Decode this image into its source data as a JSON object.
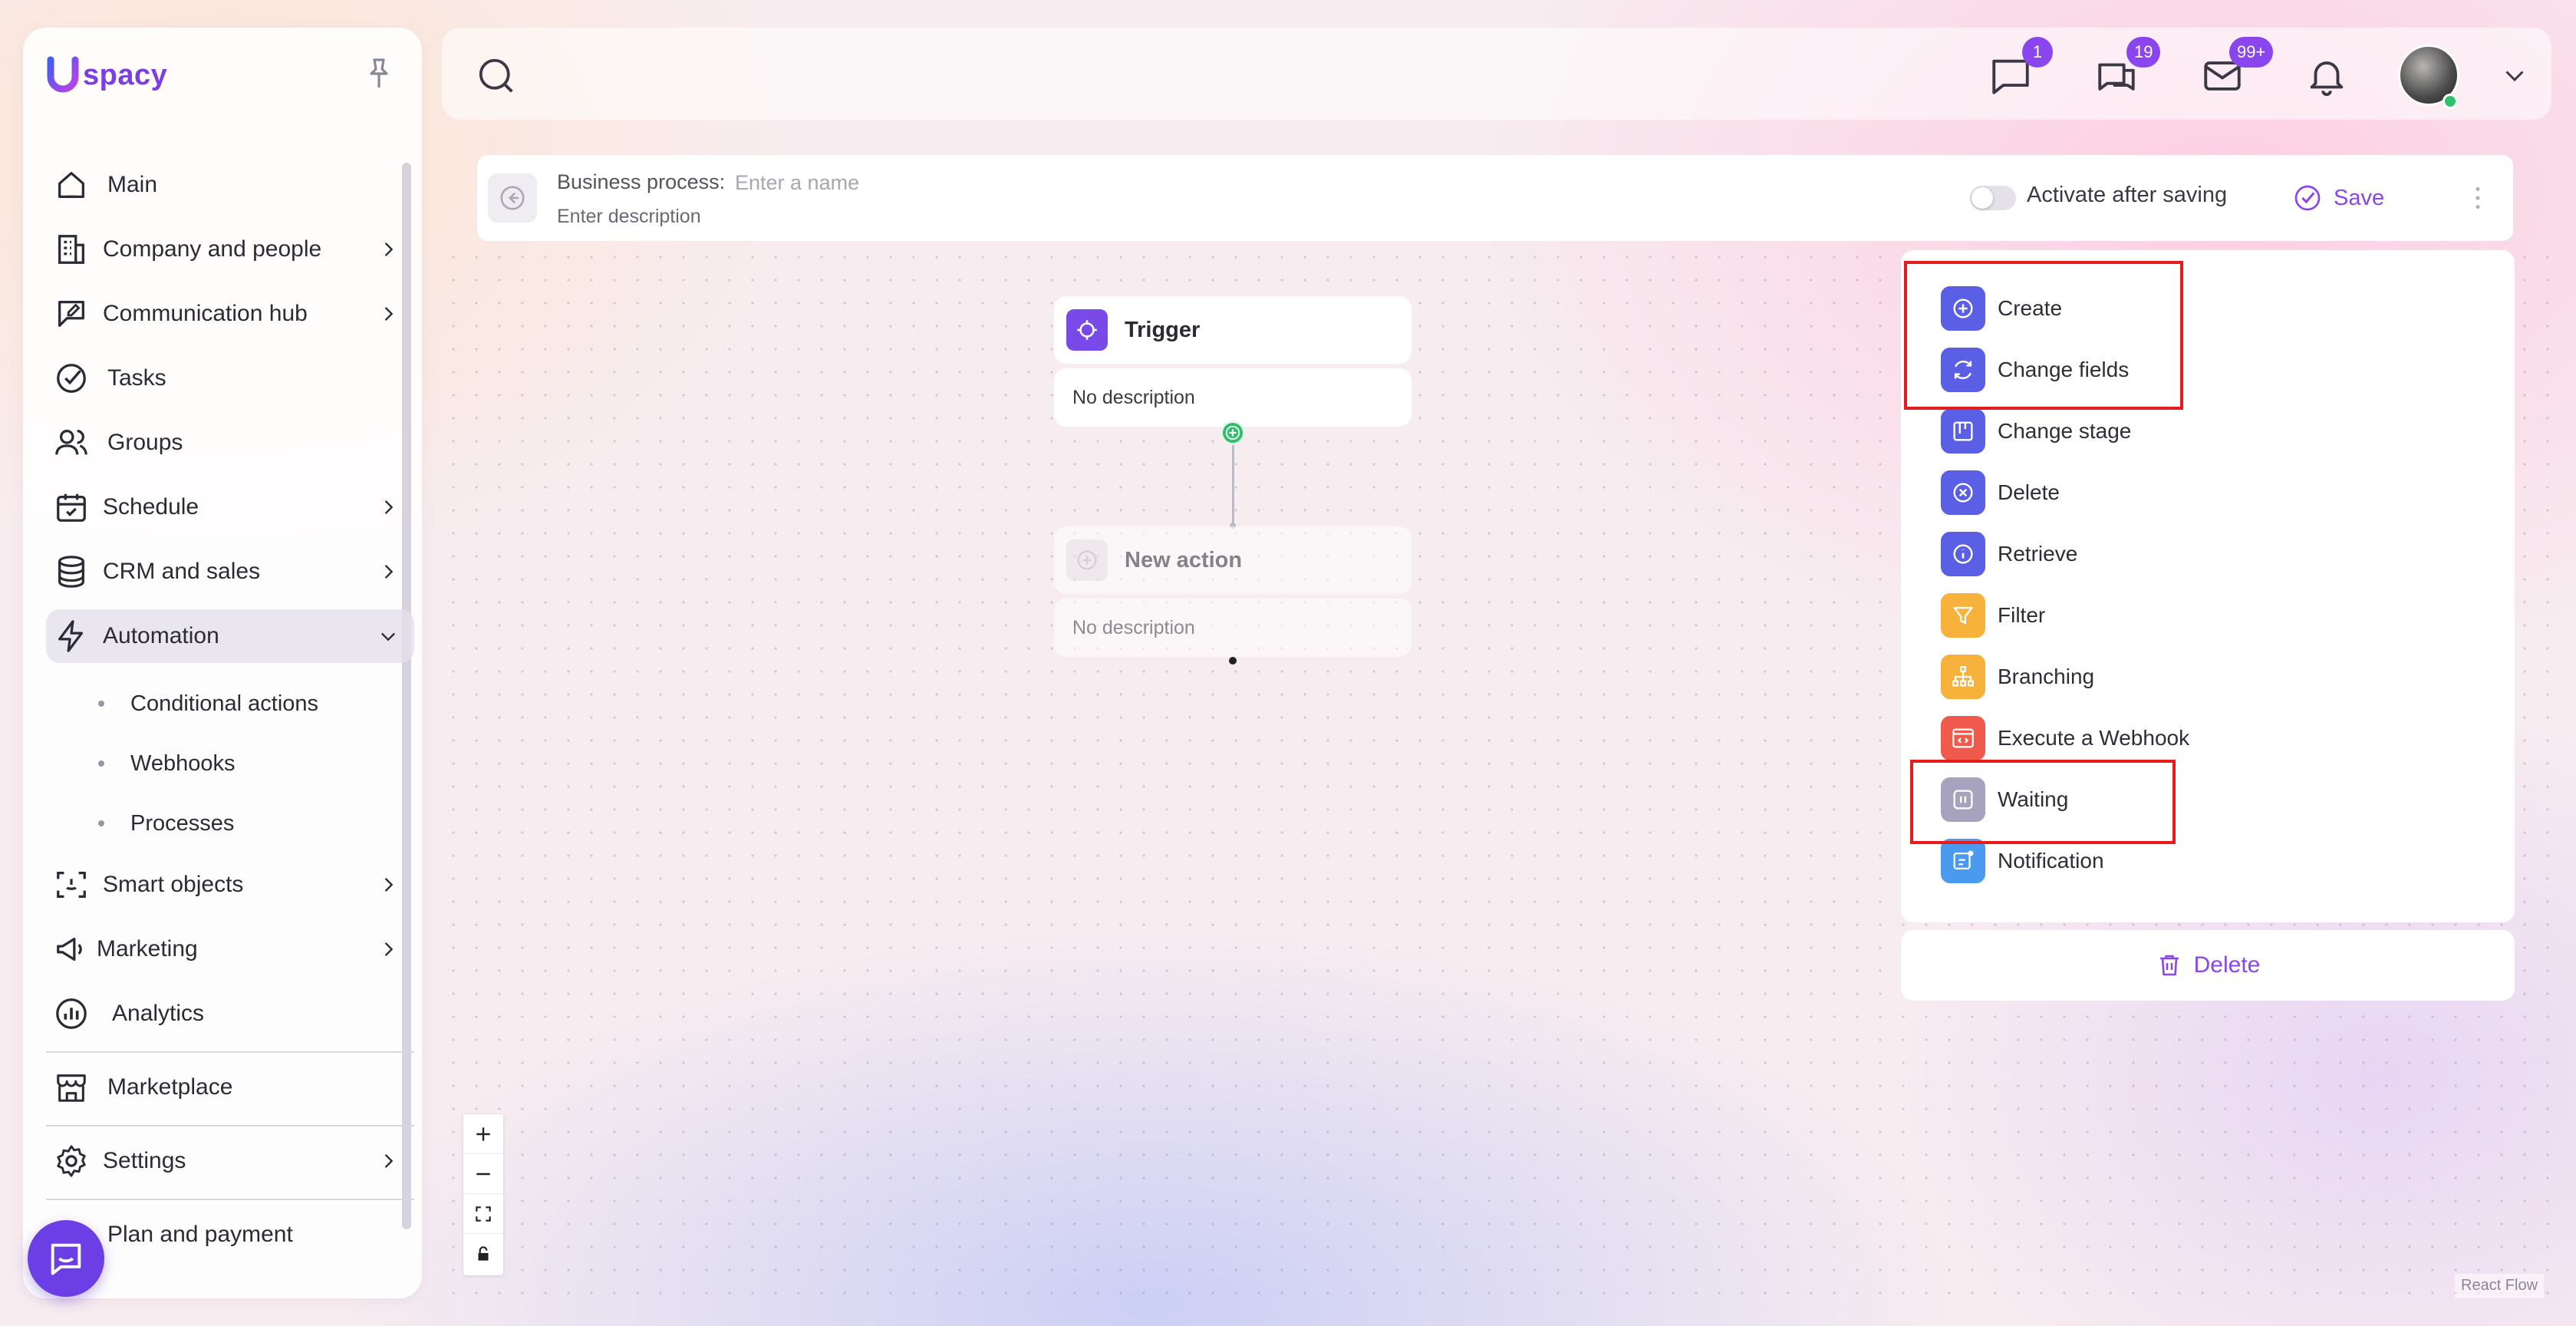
{
  "app": {
    "brand": "spacy"
  },
  "sidebar": {
    "items": [
      {
        "label": "Main",
        "icon": "home-icon"
      },
      {
        "label": "Company and people",
        "icon": "building-icon",
        "has_children": true
      },
      {
        "label": "Communication hub",
        "icon": "chat-edit-icon",
        "has_children": true
      },
      {
        "label": "Tasks",
        "icon": "check-circle-icon"
      },
      {
        "label": "Groups",
        "icon": "users-icon"
      },
      {
        "label": "Schedule",
        "icon": "calendar-icon",
        "has_children": true
      },
      {
        "label": "CRM and sales",
        "icon": "database-icon",
        "has_children": true
      },
      {
        "label": "Automation",
        "icon": "lightning-icon",
        "expanded": true
      }
    ],
    "automation_sub": [
      "Conditional actions",
      "Webhooks",
      "Processes"
    ],
    "items_after": [
      {
        "label": "Smart objects",
        "icon": "scan-face-icon",
        "has_children": true
      },
      {
        "label": "Marketing",
        "icon": "megaphone-icon",
        "has_children": true
      },
      {
        "label": "Analytics",
        "icon": "chart-circle-icon"
      }
    ],
    "marketplace": "Marketplace",
    "settings": "Settings",
    "plan": "Plan and payment"
  },
  "topbar": {
    "badges": {
      "chats": "1",
      "messages": "19",
      "mail": "99+"
    }
  },
  "process": {
    "title_label": "Business process:",
    "name_placeholder": "Enter a name",
    "description_placeholder": "Enter description",
    "activate_label": "Activate after saving",
    "activate_on": false,
    "save_label": "Save"
  },
  "flow": {
    "trigger": {
      "title": "Trigger",
      "description": "No description"
    },
    "new_action": {
      "title": "New action",
      "description": "No description"
    }
  },
  "actions": [
    {
      "label": "Create",
      "icon": "plus-circle-icon",
      "color": "#5b5fe6"
    },
    {
      "label": "Change fields",
      "icon": "refresh-icon",
      "color": "#5b5fe6"
    },
    {
      "label": "Change stage",
      "icon": "kanban-icon",
      "color": "#5b5fe6"
    },
    {
      "label": "Delete",
      "icon": "x-circle-icon",
      "color": "#5b5fe6"
    },
    {
      "label": "Retrieve",
      "icon": "info-circle-icon",
      "color": "#5b5fe6"
    },
    {
      "label": "Filter",
      "icon": "funnel-icon",
      "color": "#f7b23b"
    },
    {
      "label": "Branching",
      "icon": "tree-icon",
      "color": "#f7b23b"
    },
    {
      "label": "Execute a Webhook",
      "icon": "code-window-icon",
      "color": "#ef5a4c"
    },
    {
      "label": "Waiting",
      "icon": "pause-icon",
      "color": "#a7a2bd"
    },
    {
      "label": "Notification",
      "icon": "message-card-icon",
      "color": "#4a9bf0"
    }
  ],
  "delete_label": "Delete",
  "attribution": "React Flow",
  "colors": {
    "accent": "#8b45ef",
    "highlight": "#e61c1c",
    "green": "#2fbf6a"
  }
}
